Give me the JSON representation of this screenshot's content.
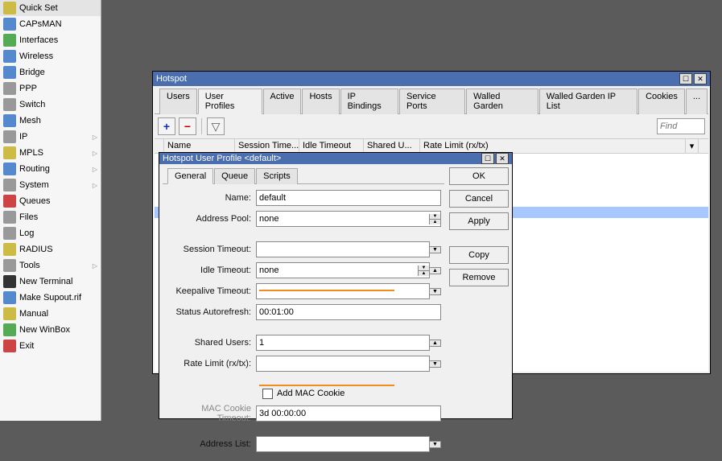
{
  "sidebar": {
    "items": [
      {
        "label": "Quick Set",
        "icon": "wand-icon",
        "iconClass": "ic-yellow",
        "arrow": false
      },
      {
        "label": "CAPsMAN",
        "icon": "caps-icon",
        "iconClass": "ic-blue",
        "arrow": false
      },
      {
        "label": "Interfaces",
        "icon": "interfaces-icon",
        "iconClass": "ic-green",
        "arrow": false
      },
      {
        "label": "Wireless",
        "icon": "wireless-icon",
        "iconClass": "ic-blue",
        "arrow": false
      },
      {
        "label": "Bridge",
        "icon": "bridge-icon",
        "iconClass": "ic-blue",
        "arrow": false
      },
      {
        "label": "PPP",
        "icon": "ppp-icon",
        "iconClass": "ic-gray",
        "arrow": false
      },
      {
        "label": "Switch",
        "icon": "switch-icon",
        "iconClass": "ic-gray",
        "arrow": false
      },
      {
        "label": "Mesh",
        "icon": "mesh-icon",
        "iconClass": "ic-blue",
        "arrow": false
      },
      {
        "label": "IP",
        "icon": "ip-icon",
        "iconClass": "ic-gray",
        "arrow": true
      },
      {
        "label": "MPLS",
        "icon": "mpls-icon",
        "iconClass": "ic-yellow",
        "arrow": true
      },
      {
        "label": "Routing",
        "icon": "routing-icon",
        "iconClass": "ic-blue",
        "arrow": true
      },
      {
        "label": "System",
        "icon": "system-icon",
        "iconClass": "ic-gray",
        "arrow": true
      },
      {
        "label": "Queues",
        "icon": "queues-icon",
        "iconClass": "ic-red",
        "arrow": false
      },
      {
        "label": "Files",
        "icon": "files-icon",
        "iconClass": "ic-gray",
        "arrow": false
      },
      {
        "label": "Log",
        "icon": "log-icon",
        "iconClass": "ic-gray",
        "arrow": false
      },
      {
        "label": "RADIUS",
        "icon": "radius-icon",
        "iconClass": "ic-yellow",
        "arrow": false
      },
      {
        "label": "Tools",
        "icon": "tools-icon",
        "iconClass": "ic-gray",
        "arrow": true
      },
      {
        "label": "New Terminal",
        "icon": "terminal-icon",
        "iconClass": "ic-dark",
        "arrow": false
      },
      {
        "label": "Make Supout.rif",
        "icon": "supout-icon",
        "iconClass": "ic-blue",
        "arrow": false
      },
      {
        "label": "Manual",
        "icon": "manual-icon",
        "iconClass": "ic-yellow",
        "arrow": false
      },
      {
        "label": "New WinBox",
        "icon": "winbox-icon",
        "iconClass": "ic-green",
        "arrow": false
      },
      {
        "label": "Exit",
        "icon": "exit-icon",
        "iconClass": "ic-red",
        "arrow": false
      }
    ]
  },
  "hotspot_window": {
    "title": "Hotspot",
    "tabs": [
      "Users",
      "User Profiles",
      "Active",
      "Hosts",
      "IP Bindings",
      "Service Ports",
      "Walled Garden",
      "Walled Garden IP List",
      "Cookies",
      "..."
    ],
    "active_tab": 1,
    "find_placeholder": "Find",
    "columns": [
      "",
      "Name",
      "Session Time...",
      "Idle Timeout",
      "Shared U...",
      "Rate Limit (rx/tx)"
    ]
  },
  "profile_dialog": {
    "title": "Hotspot User Profile <default>",
    "tabs": [
      "General",
      "Queue",
      "Scripts"
    ],
    "active_tab": 0,
    "buttons": {
      "ok": "OK",
      "cancel": "Cancel",
      "apply": "Apply",
      "copy": "Copy",
      "remove": "Remove"
    },
    "fields": {
      "name_label": "Name:",
      "name_value": "default",
      "address_pool_label": "Address Pool:",
      "address_pool_value": "none",
      "session_timeout_label": "Session Timeout:",
      "session_timeout_value": "",
      "idle_timeout_label": "Idle Timeout:",
      "idle_timeout_value": "none",
      "keepalive_timeout_label": "Keepalive Timeout:",
      "keepalive_timeout_value": "",
      "status_autorefresh_label": "Status Autorefresh:",
      "status_autorefresh_value": "00:01:00",
      "shared_users_label": "Shared Users:",
      "shared_users_value": "1",
      "rate_limit_label": "Rate Limit (rx/tx):",
      "rate_limit_value": "",
      "add_mac_cookie_label": "Add MAC Cookie",
      "mac_cookie_timeout_label": "MAC Cookie Timeout:",
      "mac_cookie_timeout_value": "3d 00:00:00",
      "address_list_label": "Address List:",
      "address_list_value": ""
    }
  }
}
